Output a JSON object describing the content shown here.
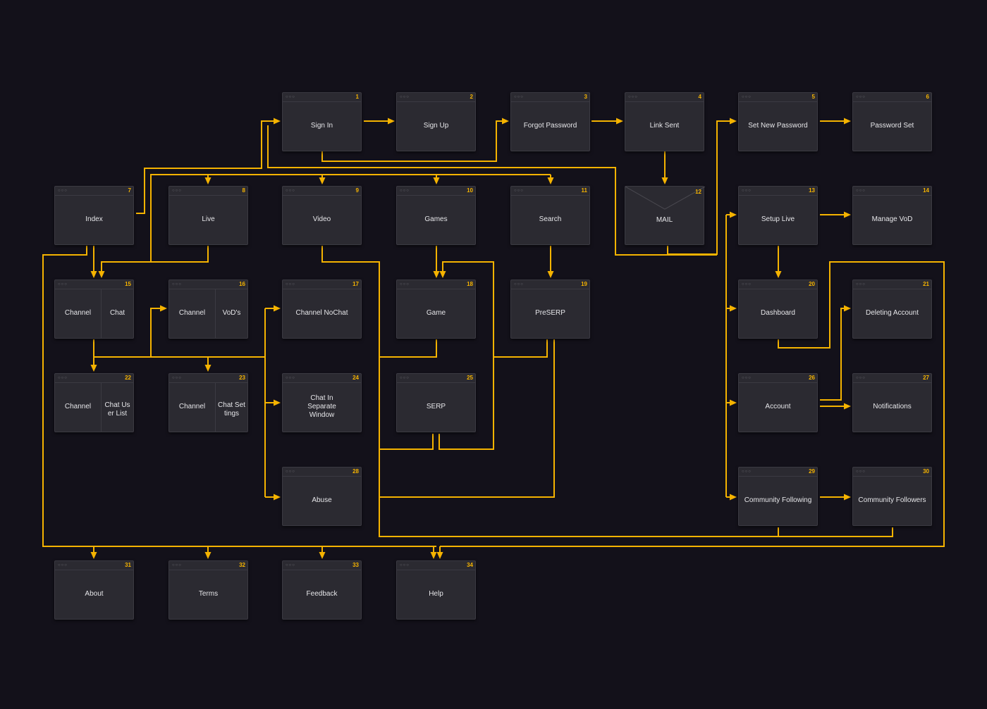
{
  "colors": {
    "background": "#13111a",
    "wire": "#f5b300",
    "card": "#2b2a31"
  },
  "nodes": [
    {
      "id": "n1",
      "num": "1",
      "label": "Sign In"
    },
    {
      "id": "n2",
      "num": "2",
      "label": "Sign Up"
    },
    {
      "id": "n3",
      "num": "3",
      "label": "Forgot Password"
    },
    {
      "id": "n4",
      "num": "4",
      "label": "Link Sent"
    },
    {
      "id": "n5",
      "num": "5",
      "label": "Set New Password"
    },
    {
      "id": "n6",
      "num": "6",
      "label": "Password Set"
    },
    {
      "id": "n7",
      "num": "7",
      "label": "Index"
    },
    {
      "id": "n8",
      "num": "8",
      "label": "Live"
    },
    {
      "id": "n9",
      "num": "9",
      "label": "Video"
    },
    {
      "id": "n10",
      "num": "10",
      "label": "Games"
    },
    {
      "id": "n11",
      "num": "11",
      "label": "Search"
    },
    {
      "id": "n12",
      "num": "12",
      "label": "MAIL"
    },
    {
      "id": "n13",
      "num": "13",
      "label": "Setup Live"
    },
    {
      "id": "n14",
      "num": "14",
      "label": "Manage VoD"
    },
    {
      "id": "n15",
      "num": "15",
      "label": "Channel",
      "sublabel": "Chat"
    },
    {
      "id": "n16",
      "num": "16",
      "label": "Channel",
      "sublabel": "VoD's"
    },
    {
      "id": "n17",
      "num": "17",
      "label": "Channel NoChat"
    },
    {
      "id": "n18",
      "num": "18",
      "label": "Game"
    },
    {
      "id": "n19",
      "num": "19",
      "label": "PreSERP"
    },
    {
      "id": "n20",
      "num": "20",
      "label": "Dashboard"
    },
    {
      "id": "n21",
      "num": "21",
      "label": "Deleting Account"
    },
    {
      "id": "n22",
      "num": "22",
      "label": "Channel",
      "sublabel": "Chat User List"
    },
    {
      "id": "n23",
      "num": "23",
      "label": "Channel",
      "sublabel": "Chat Settings"
    },
    {
      "id": "n24",
      "num": "24",
      "label": "Chat In Separate Window"
    },
    {
      "id": "n25",
      "num": "25",
      "label": "SERP"
    },
    {
      "id": "n26",
      "num": "26",
      "label": "Account"
    },
    {
      "id": "n27",
      "num": "27",
      "label": "Notifications"
    },
    {
      "id": "n28",
      "num": "28",
      "label": "Abuse"
    },
    {
      "id": "n29",
      "num": "29",
      "label": "Community Following"
    },
    {
      "id": "n30",
      "num": "30",
      "label": "Community Followers"
    },
    {
      "id": "n31",
      "num": "31",
      "label": "About"
    },
    {
      "id": "n32",
      "num": "32",
      "label": "Terms"
    },
    {
      "id": "n33",
      "num": "33",
      "label": "Feedback"
    },
    {
      "id": "n34",
      "num": "34",
      "label": "Help"
    }
  ]
}
